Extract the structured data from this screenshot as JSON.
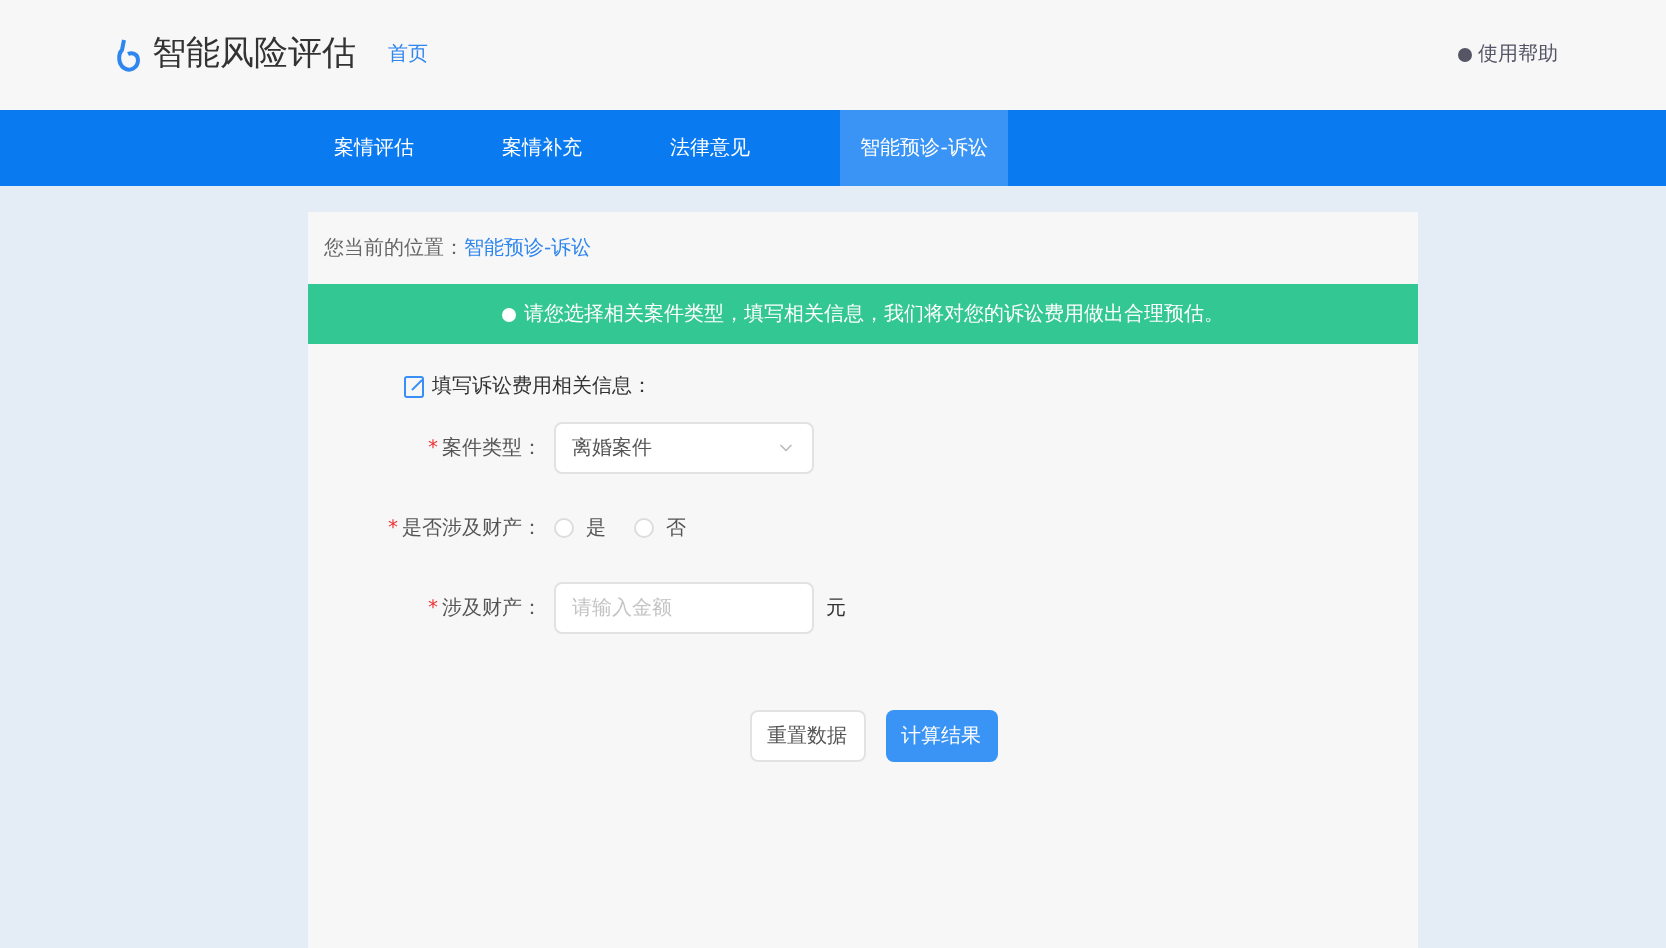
{
  "header": {
    "title": "智能风险评估",
    "home_link": "首页",
    "help": "使用帮助"
  },
  "nav": [
    {
      "label": "案情评估",
      "selected": false
    },
    {
      "label": "案情补充",
      "selected": false
    },
    {
      "label": "法律意见",
      "selected": false
    },
    {
      "label": "智能预诊-诉讼",
      "selected": true
    }
  ],
  "breadcrumb": {
    "prefix": "您当前的位置：",
    "current": "智能预诊-诉讼"
  },
  "alert": "请您选择相关案件类型，填写相关信息，我们将对您的诉讼费用做出合理预估。",
  "form": {
    "heading": "填写诉讼费用相关信息：",
    "fields": [
      {
        "kind": "select",
        "label": "案件类型：",
        "required_mark": "*",
        "value": "离婚案件"
      },
      {
        "kind": "radio",
        "label": "是否涉及财产：",
        "required_mark": "*",
        "options": [
          {
            "label": "是",
            "selected": false
          },
          {
            "label": "否",
            "selected": false
          }
        ]
      },
      {
        "kind": "input",
        "label": "涉及财产：",
        "required_mark": "*",
        "placeholder": "请输入金额",
        "unit": "元"
      }
    ]
  },
  "buttons": [
    {
      "label": "重置数据",
      "kind": "secondary"
    },
    {
      "label": "计算结果",
      "kind": "primary"
    }
  ]
}
